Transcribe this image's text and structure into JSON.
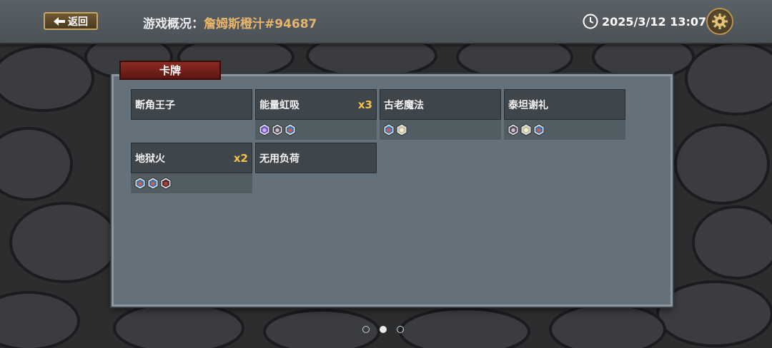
{
  "header": {
    "back_label": "返回",
    "title_label": "游戏概况：",
    "title_name": "詹姆斯橙汁#94687",
    "datetime": "2025/3/12 13:07"
  },
  "section": {
    "tab_label": "卡牌"
  },
  "cards": [
    {
      "name": "断角王子",
      "count": "",
      "icons": []
    },
    {
      "name": "能量虹吸",
      "count": "x3",
      "icons": [
        "purple-gem-icon",
        "dark-gem-icon",
        "blue-gem-icon"
      ]
    },
    {
      "name": "古老魔法",
      "count": "",
      "icons": [
        "blue-gem-icon",
        "light-gem-icon"
      ]
    },
    {
      "name": "泰坦谢礼",
      "count": "",
      "icons": [
        "dark-gem-icon",
        "light-gem-icon",
        "blue-gem-icon"
      ]
    },
    {
      "name": "地狱火",
      "count": "x2",
      "icons": [
        "blue-gem-icon",
        "blue-gem-icon",
        "red-gem-icon"
      ]
    },
    {
      "name": "无用负荷",
      "count": "",
      "icons": []
    }
  ],
  "pagination": {
    "pages": 3,
    "current": 2
  },
  "colors": {
    "accent_gold": "#e7b56a",
    "count_yellow": "#f2c14e",
    "tab_red": "#7a211b"
  }
}
